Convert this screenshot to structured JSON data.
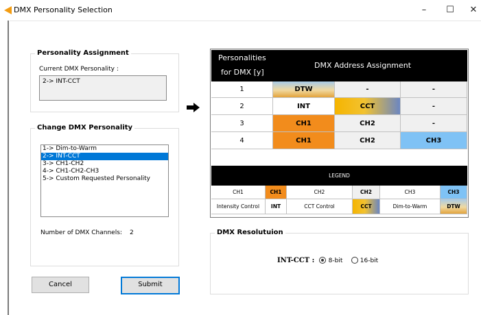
{
  "window": {
    "title": "DMX Personality Selection",
    "controls": {
      "minimize": "–",
      "maximize": "☐",
      "close": "✕"
    }
  },
  "personality_assignment": {
    "title": "Personality Assignment",
    "current_label": "Current DMX Personality :",
    "current_value": "2-> INT-CCT"
  },
  "change_personality": {
    "title": "Change DMX Personality",
    "options": [
      "1-> Dim-to-Warm",
      "2-> INT-CCT",
      "3-> CH1-CH2",
      "4-> CH1-CH2-CH3",
      "5-> Custom Requested Personality"
    ],
    "selected_index": 1,
    "channels_label": "Number of DMX Channels:",
    "channels_value": "2"
  },
  "buttons": {
    "cancel": "Cancel",
    "submit": "Submit"
  },
  "assignment_table": {
    "header_left_line1": "Personalities",
    "header_left_line2": "for DMX [y]",
    "header_right": "DMX Address Assignment",
    "rows": [
      {
        "num": "1",
        "cells": [
          "DTW",
          "-",
          "-"
        ]
      },
      {
        "num": "2",
        "cells": [
          "INT",
          "CCT",
          "-"
        ]
      },
      {
        "num": "3",
        "cells": [
          "CH1",
          "CH2",
          "-"
        ]
      },
      {
        "num": "4",
        "cells": [
          "CH1",
          "CH2",
          "CH3"
        ]
      }
    ]
  },
  "legend": {
    "title": "LEGEND",
    "row1": [
      "CH1",
      "CH1",
      "CH2",
      "CH2",
      "CH3",
      "CH3"
    ],
    "row2": [
      "Intensity Control",
      "INT",
      "CCT Control",
      "CCT",
      "Dim-to-Warm",
      "DTW"
    ]
  },
  "resolution": {
    "title": "DMX Resolutuion",
    "label": "INT-CCT :",
    "option_8bit": "8-bit",
    "option_16bit": "16-bit",
    "selected": "8-bit"
  },
  "colors": {
    "orange": "#f28c1c",
    "light_gray": "#f0f0f0",
    "light_blue": "#7fc2f5",
    "selection_blue": "#0078d7",
    "app_icon": "#f39c12"
  },
  "icons": {
    "app": "orange-triangle-icon",
    "pointer": "right-arrow-icon"
  }
}
